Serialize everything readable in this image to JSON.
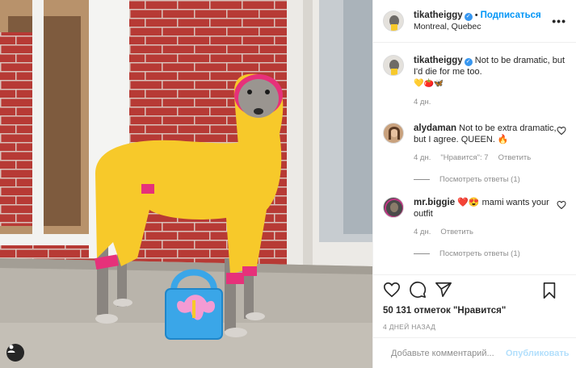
{
  "post": {
    "username": "tikatheiggy",
    "follow_label": "Подписаться",
    "separator": "•",
    "location": "Montreal, Quebec",
    "more_label": "•••",
    "verified_mark": "✓"
  },
  "caption": {
    "username": "tikatheiggy",
    "text": "Not to be dramatic, but I'd die for me too.",
    "emojis": "💛🍅🦋",
    "time": "4 дн."
  },
  "comments": [
    {
      "username": "alydaman",
      "text": "Not to be extra dramatic, but I agree. QUEEN. 🔥",
      "time": "4 дн.",
      "likes": "\"Нравится\": 7",
      "reply_label": "Ответить",
      "view_replies": "Посмотреть ответы (1)"
    },
    {
      "username": "mr.biggie",
      "text": "❤️😍 mami wants your outfit",
      "time": "4 дн.",
      "reply_label": "Ответить",
      "view_replies": "Посмотреть ответы (1)"
    }
  ],
  "likes_text": "50 131 отметок \"Нравится\"",
  "date_text": "4 ДНЕЙ НАЗАД",
  "add_comment": {
    "placeholder": "Добавьте комментарий...",
    "post_label": "Опубликовать"
  },
  "colors": {
    "accent": "#0095f6",
    "verified": "#3897f0",
    "muted": "#8e8e8e",
    "sweater": "#f7c92a",
    "cuffs": "#e6317a",
    "bag": "#3aa6e8"
  }
}
